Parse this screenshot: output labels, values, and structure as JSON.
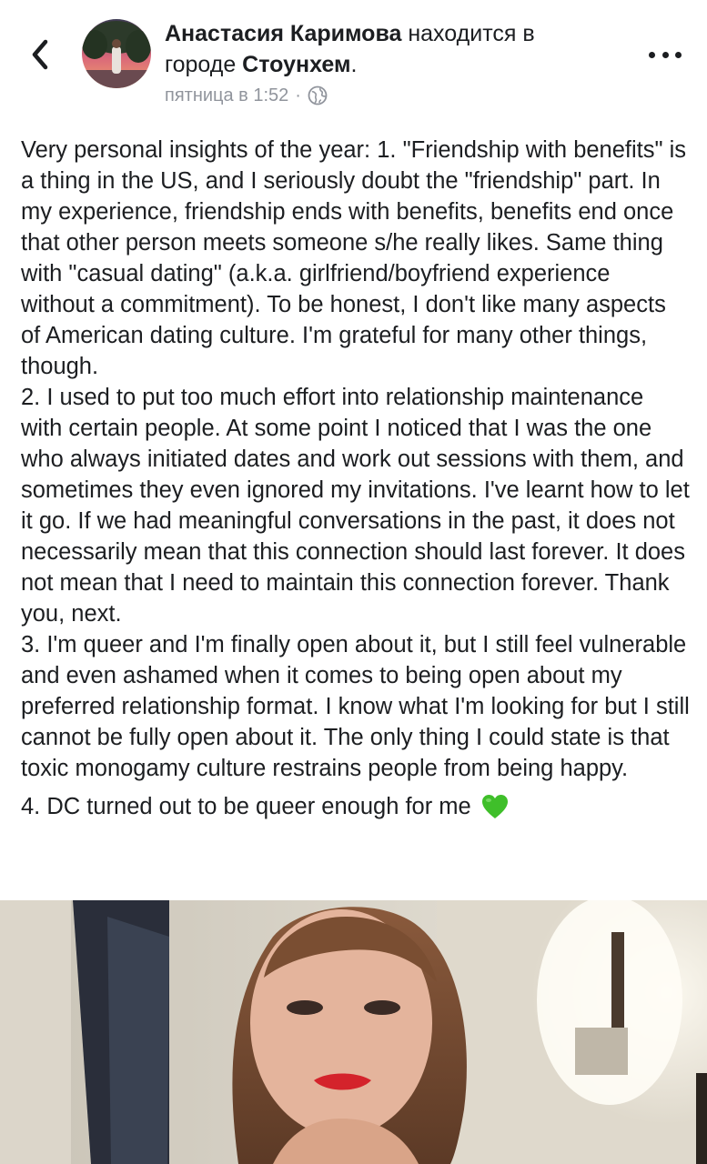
{
  "header": {
    "author_name": "Анастасия Каримова",
    "location_prefix": " находится в",
    "location_city_prefix": "городе ",
    "location_city": "Стоунхем",
    "location_suffix": ".",
    "timestamp": "пятница в 1:52",
    "separator": "·",
    "privacy_icon": "globe-icon",
    "back_icon": "chevron-left-icon",
    "more_icon": "more-dots-icon"
  },
  "post": {
    "paragraph_1": "Very personal insights of the year: 1. \"Friendship with benefits\" is a thing in the US, and I seriously doubt the \"friendship\" part. In my experience, friendship ends with benefits, benefits end once that other person meets someone s/he really likes. Same thing with \"casual dating\" (a.k.a. girlfriend/boyfriend experience without a commitment). To be honest, I don't like many aspects of American dating culture. I'm grateful for many other things, though.",
    "paragraph_2": "2. I used to put too much effort into relationship maintenance with certain people. At some point I noticed that I was the one who always initiated dates and work out sessions with them, and sometimes they even ignored my invitations. I've learnt how to let it go. If we had meaningful conversations in the past, it does not necessarily mean that this connection should last forever. It does not mean that I need to maintain this connection forever. Thank you, next.",
    "paragraph_3": "3. I'm queer and I'm finally open about it, but I still feel vulnerable and even ashamed when it comes to being open about my preferred relationship format. I know what I'm looking for but I still cannot be fully open about it. The only thing I could state is that toxic monogamy culture restrains people from being happy.",
    "paragraph_4": "4. DC turned out to be queer enough for me",
    "emoji": "green-heart-icon"
  },
  "colors": {
    "text": "#1c1e21",
    "meta": "#90949c",
    "heart": "#3fbf2a"
  }
}
